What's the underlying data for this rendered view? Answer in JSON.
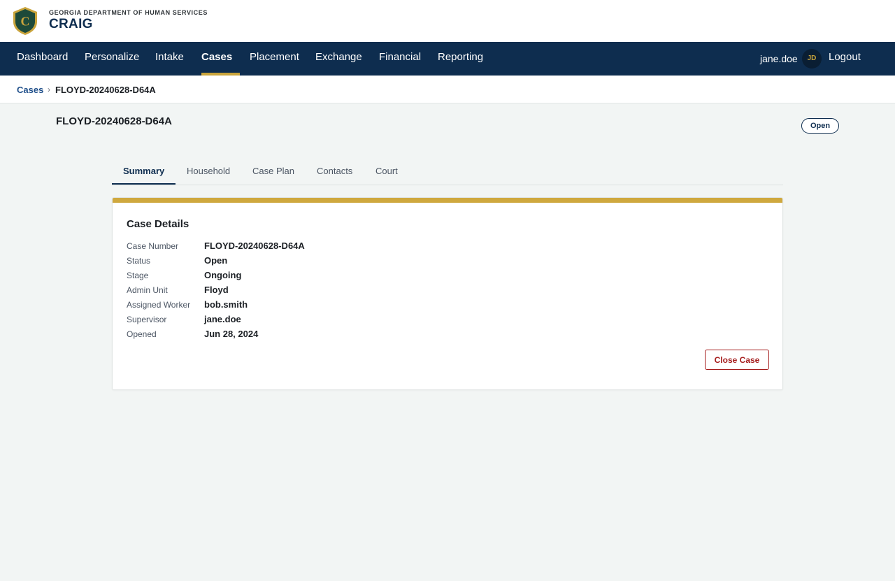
{
  "header": {
    "agency": "GEORGIA DEPARTMENT OF HUMAN SERVICES",
    "app_name": "CRAIG",
    "logo_letter": "C",
    "logo_icon": "shield-logo-icon"
  },
  "nav": {
    "items": [
      {
        "label": "Dashboard"
      },
      {
        "label": "Personalize"
      },
      {
        "label": "Intake"
      },
      {
        "label": "Cases",
        "active": true
      },
      {
        "label": "Placement"
      },
      {
        "label": "Exchange"
      },
      {
        "label": "Financial"
      },
      {
        "label": "Reporting"
      }
    ],
    "user": "jane.doe",
    "avatar_initials": "JD",
    "logout": "Logout"
  },
  "breadcrumb": {
    "root": "Cases",
    "separator": "›",
    "current": "FLOYD-20240628-D64A"
  },
  "case": {
    "title": "FLOYD-20240628-D64A",
    "status_badge": "Open"
  },
  "tabs": [
    {
      "label": "Summary",
      "active": true
    },
    {
      "label": "Household"
    },
    {
      "label": "Case Plan"
    },
    {
      "label": "Contacts"
    },
    {
      "label": "Court"
    }
  ],
  "details": {
    "title": "Case Details",
    "rows": [
      {
        "label": "Case Number",
        "value": "FLOYD-20240628-D64A"
      },
      {
        "label": "Status",
        "value": "Open"
      },
      {
        "label": "Stage",
        "value": "Ongoing"
      },
      {
        "label": "Admin Unit",
        "value": "Floyd"
      },
      {
        "label": "Assigned Worker",
        "value": "bob.smith"
      },
      {
        "label": "Supervisor",
        "value": "jane.doe"
      },
      {
        "label": "Opened",
        "value": "Jun 28, 2024"
      }
    ],
    "close_button": "Close Case"
  },
  "colors": {
    "navy": "#0e2d4f",
    "gold": "#c9a43c",
    "danger": "#a51c1c",
    "background": "#f2f5f4"
  }
}
